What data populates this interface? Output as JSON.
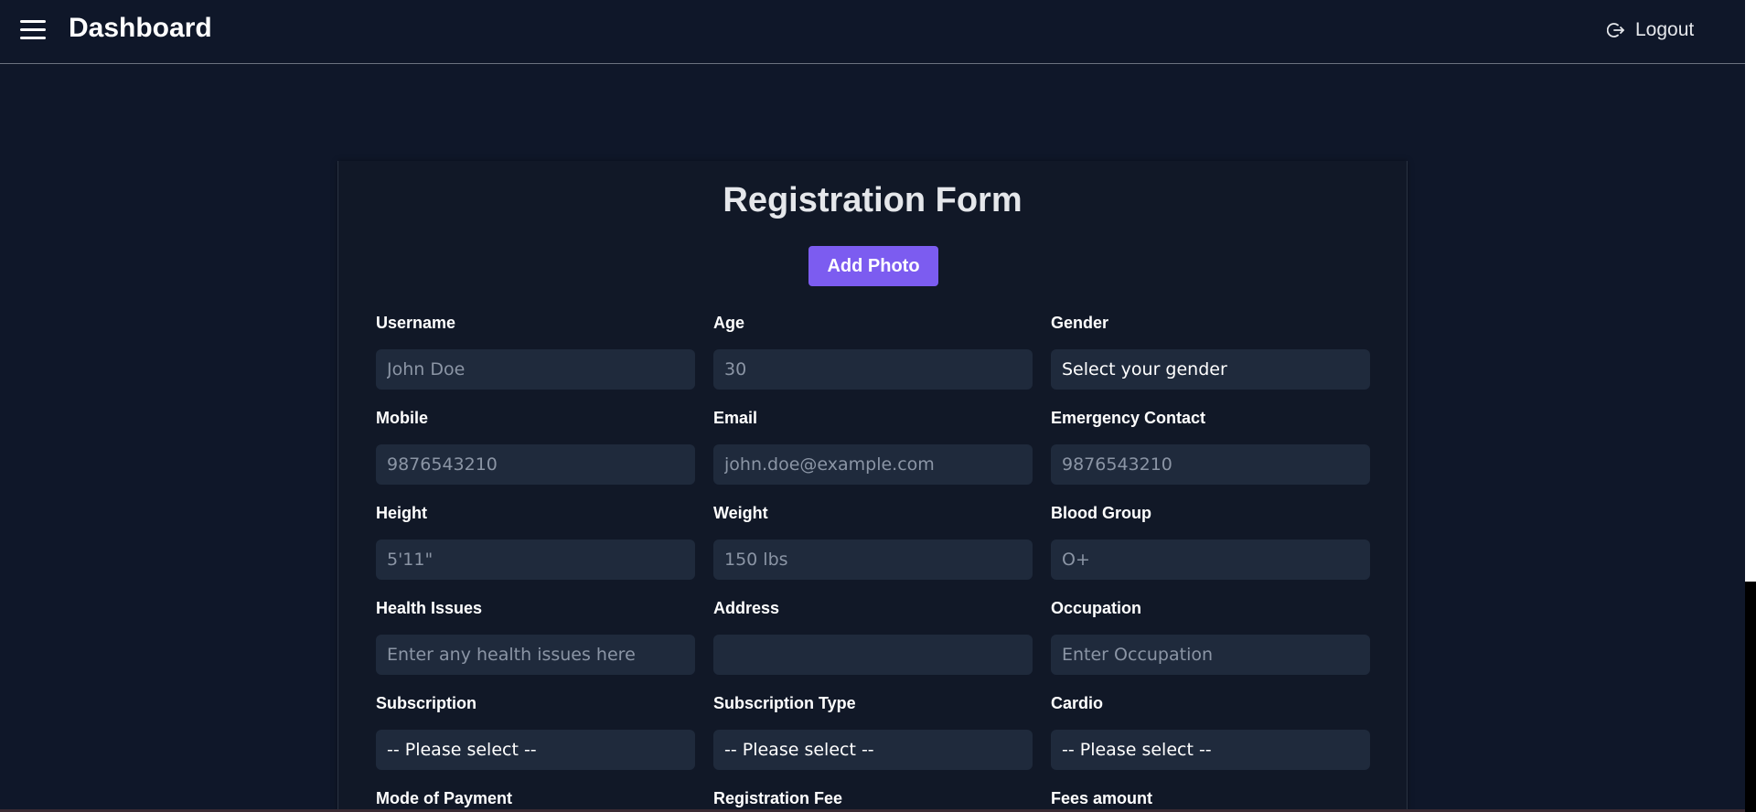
{
  "header": {
    "title": "Dashboard",
    "logout_label": "Logout"
  },
  "form": {
    "title": "Registration Form",
    "add_photo_label": "Add Photo",
    "fields": [
      {
        "label": "Username",
        "type": "input",
        "placeholder": "John Doe",
        "value": ""
      },
      {
        "label": "Age",
        "type": "input",
        "placeholder": "30",
        "value": ""
      },
      {
        "label": "Gender",
        "type": "select",
        "value": "Select your gender"
      },
      {
        "label": "Mobile",
        "type": "input",
        "placeholder": "9876543210",
        "value": ""
      },
      {
        "label": "Email",
        "type": "input",
        "placeholder": "john.doe@example.com",
        "value": ""
      },
      {
        "label": "Emergency Contact",
        "type": "input",
        "placeholder": "9876543210",
        "value": ""
      },
      {
        "label": "Height",
        "type": "input",
        "placeholder": "5'11\"",
        "value": ""
      },
      {
        "label": "Weight",
        "type": "input",
        "placeholder": "150 lbs",
        "value": ""
      },
      {
        "label": "Blood Group",
        "type": "input",
        "placeholder": "O+",
        "value": ""
      },
      {
        "label": "Health Issues",
        "type": "input",
        "placeholder": "Enter any health issues here",
        "value": ""
      },
      {
        "label": "Address",
        "type": "input",
        "placeholder": "",
        "value": ""
      },
      {
        "label": "Occupation",
        "type": "input",
        "placeholder": "Enter Occupation",
        "value": ""
      },
      {
        "label": "Subscription",
        "type": "select",
        "value": "-- Please select --"
      },
      {
        "label": "Subscription Type",
        "type": "select",
        "value": "-- Please select --"
      },
      {
        "label": "Cardio",
        "type": "select",
        "value": "-- Please select --"
      },
      {
        "label": "Mode of Payment",
        "type": "partial"
      },
      {
        "label": "Registration Fee",
        "type": "partial"
      },
      {
        "label": "Fees amount",
        "type": "partial"
      }
    ]
  },
  "icons": {
    "menu": "hamburger-menu-icon",
    "logout": "logout-icon"
  }
}
